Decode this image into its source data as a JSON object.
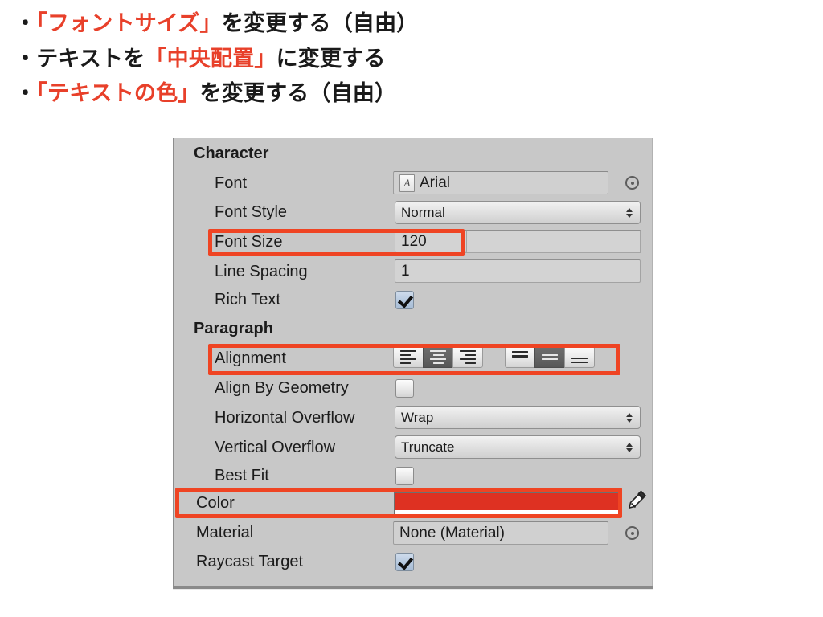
{
  "slide": {
    "bullets": [
      {
        "marker": "・",
        "segments": [
          {
            "text": "「フォントサイズ」",
            "highlight": true
          },
          {
            "text": "を変更する（自由）",
            "highlight": false
          }
        ]
      },
      {
        "marker": "・",
        "segments": [
          {
            "text": "テキストを",
            "highlight": false
          },
          {
            "text": "「中央配置」",
            "highlight": true
          },
          {
            "text": "に変更する",
            "highlight": false
          }
        ]
      },
      {
        "marker": "・",
        "segments": [
          {
            "text": "「テキストの色」",
            "highlight": true
          },
          {
            "text": "を変更する（自由）",
            "highlight": false
          }
        ]
      }
    ],
    "highlight_color": "#e8402a",
    "text_color": "#1a1a1a"
  },
  "inspector": {
    "sections": {
      "character": "Character",
      "paragraph": "Paragraph"
    },
    "rows": {
      "font": {
        "label": "Font",
        "value": "Arial",
        "icon": "font-asset-icon"
      },
      "font_style": {
        "label": "Font Style",
        "value": "Normal"
      },
      "font_size": {
        "label": "Font Size",
        "value": "120"
      },
      "line_spacing": {
        "label": "Line Spacing",
        "value": "1"
      },
      "rich_text": {
        "label": "Rich Text",
        "checked": true
      },
      "alignment": {
        "label": "Alignment"
      },
      "align_by_geometry": {
        "label": "Align By Geometry",
        "checked": false
      },
      "horizontal_overflow": {
        "label": "Horizontal Overflow",
        "value": "Wrap"
      },
      "vertical_overflow": {
        "label": "Vertical Overflow",
        "value": "Truncate"
      },
      "best_fit": {
        "label": "Best Fit",
        "checked": false
      },
      "color": {
        "label": "Color",
        "value": "#DE3122",
        "alpha": "#ffffff"
      },
      "material": {
        "label": "Material",
        "value": "None (Material)"
      },
      "raycast_target": {
        "label": "Raycast Target",
        "checked": true
      }
    },
    "alignment": {
      "horizontal": [
        {
          "name": "align-left",
          "selected": false
        },
        {
          "name": "align-center",
          "selected": true
        },
        {
          "name": "align-right",
          "selected": false
        }
      ],
      "vertical": [
        {
          "name": "align-top",
          "selected": false
        },
        {
          "name": "align-middle",
          "selected": true
        },
        {
          "name": "align-bottom",
          "selected": false
        }
      ]
    },
    "highlight_boxes": [
      {
        "name": "font-size-highlight",
        "target": "Font Size"
      },
      {
        "name": "alignment-highlight",
        "target": "Alignment"
      },
      {
        "name": "color-highlight",
        "target": "Color"
      }
    ],
    "highlight_color": "#ef4423",
    "panel_bg": "#c8c8c8"
  }
}
